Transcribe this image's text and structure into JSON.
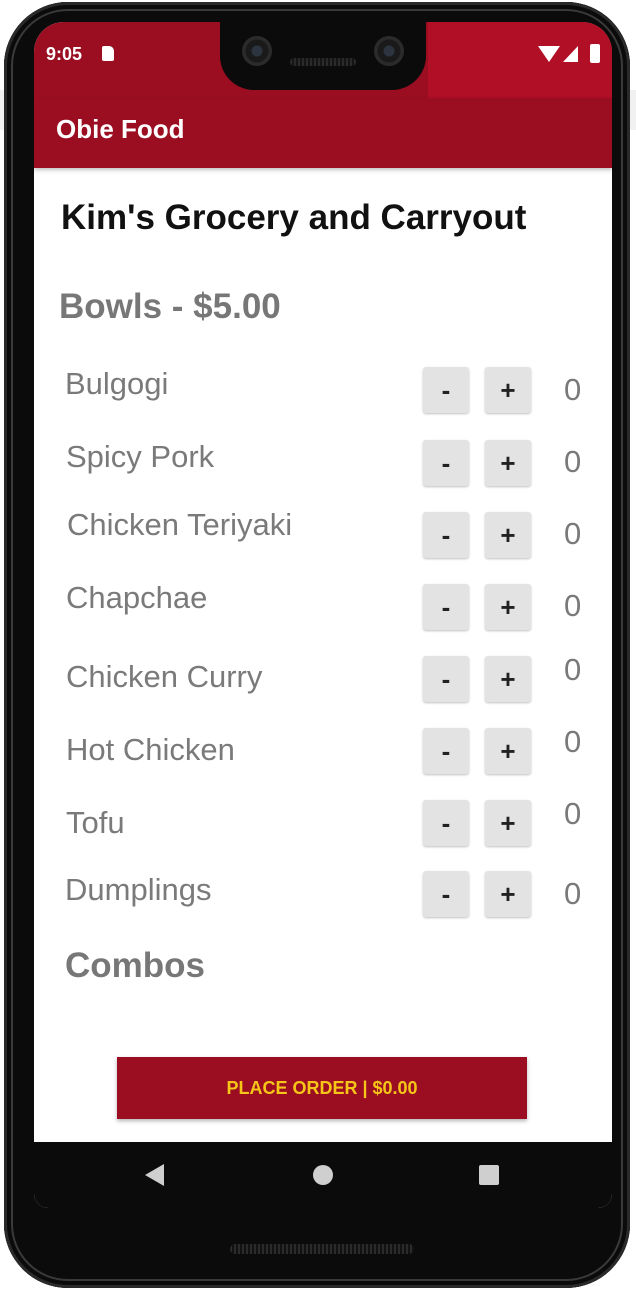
{
  "status_bar": {
    "time": "9:05"
  },
  "app_bar": {
    "title": "Obie Food"
  },
  "store": {
    "name": "Kim's Grocery and Carryout"
  },
  "sections": {
    "bowls_title": "Bowls - $5.00",
    "combos_title": "Combos"
  },
  "items": [
    {
      "name": "Bulgogi",
      "count": "0",
      "minus": "-",
      "plus": "+"
    },
    {
      "name": "Spicy Pork",
      "count": "0",
      "minus": "-",
      "plus": "+"
    },
    {
      "name": "Chicken Teriyaki",
      "count": "0",
      "minus": "-",
      "plus": "+"
    },
    {
      "name": "Chapchae",
      "count": "0",
      "minus": "-",
      "plus": "+"
    },
    {
      "name": "Chicken Curry",
      "count": "0",
      "minus": "-",
      "plus": "+"
    },
    {
      "name": "Hot Chicken",
      "count": "0",
      "minus": "-",
      "plus": "+"
    },
    {
      "name": "Tofu",
      "count": "0",
      "minus": "-",
      "plus": "+"
    },
    {
      "name": "Dumplings",
      "count": "0",
      "minus": "-",
      "plus": "+"
    }
  ],
  "order": {
    "label": "PLACE ORDER | $0.00"
  },
  "colors": {
    "brand": "#9b0e22",
    "order_text": "#f5c518",
    "item_text": "#7a7a7a"
  },
  "icons": [
    "sd-card-icon",
    "wifi-icon",
    "cell-signal-icon",
    "battery-icon",
    "back-icon",
    "home-icon",
    "recents-icon"
  ]
}
